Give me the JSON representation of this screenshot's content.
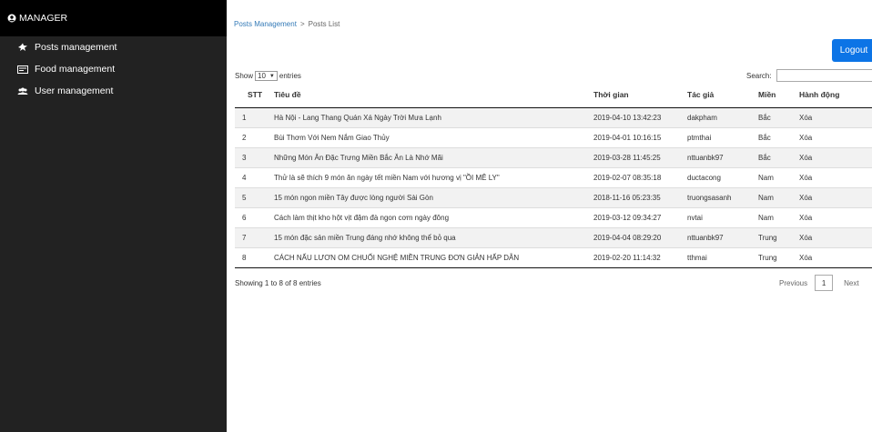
{
  "sidebar": {
    "title": "MANAGER",
    "items": [
      {
        "label": "Posts management",
        "icon": "bird-icon"
      },
      {
        "label": "Food management",
        "icon": "card-icon"
      },
      {
        "label": "User management",
        "icon": "users-icon"
      }
    ]
  },
  "breadcrumb": {
    "parent": "Posts Management",
    "separator": ">",
    "current": "Posts List"
  },
  "logout_label": "Logout",
  "length": {
    "show": "Show",
    "value": "10",
    "entries": "entries"
  },
  "search": {
    "label": "Search:",
    "value": ""
  },
  "table": {
    "headers": [
      "STT",
      "Tiêu đề",
      "Thời gian",
      "Tác giả",
      "Miền",
      "Hành động"
    ],
    "rows": [
      [
        "1",
        "Hà Nội - Lang Thang Quán Xá Ngày Trời Mưa Lạnh",
        "2019-04-10 13:42:23",
        "dakpham",
        "Bắc",
        "Xóa"
      ],
      [
        "2",
        "Bùi Thơm Với Nem Nắm Giao Thủy",
        "2019-04-01 10:16:15",
        "ptmthai",
        "Bắc",
        "Xóa"
      ],
      [
        "3",
        "Những Món Ăn Đặc Trưng Miền Bắc Ăn Là Nhớ Mãi",
        "2019-03-28 11:45:25",
        "nttuanbk97",
        "Bắc",
        "Xóa"
      ],
      [
        "4",
        "Thử là sẽ thích 9 món ăn ngày tết miền Nam với hương vị \"ỒI MÊ LY\"",
        "2019-02-07 08:35:18",
        "ductacong",
        "Nam",
        "Xóa"
      ],
      [
        "5",
        "15 món ngon miền Tây được lòng người Sài Gòn",
        "2018-11-16 05:23:35",
        "truongsasanh",
        "Nam",
        "Xóa"
      ],
      [
        "6",
        "Cách làm thịt kho hột vịt đậm đà ngon cơm ngày đông",
        "2019-03-12 09:34:27",
        "nvtai",
        "Nam",
        "Xóa"
      ],
      [
        "7",
        "15 món đặc sản miền Trung đáng nhớ không thể bỏ qua",
        "2019-04-04 08:29:20",
        "nttuanbk97",
        "Trung",
        "Xóa"
      ],
      [
        "8",
        "CÁCH NẤU LƯƠN OM CHUỐI NGHỆ MIỀN TRUNG ĐƠN GIẢN HẤP DẪN",
        "2019-02-20 11:14:32",
        "tthmai",
        "Trung",
        "Xóa"
      ]
    ]
  },
  "info": "Showing 1 to 8 of 8 entries",
  "pagination": {
    "previous": "Previous",
    "page": "1",
    "next": "Next"
  },
  "colors": {
    "sidebar_bg": "#222222",
    "header_bg": "#000000",
    "accent": "#0c74e6",
    "link": "#337ab7"
  }
}
